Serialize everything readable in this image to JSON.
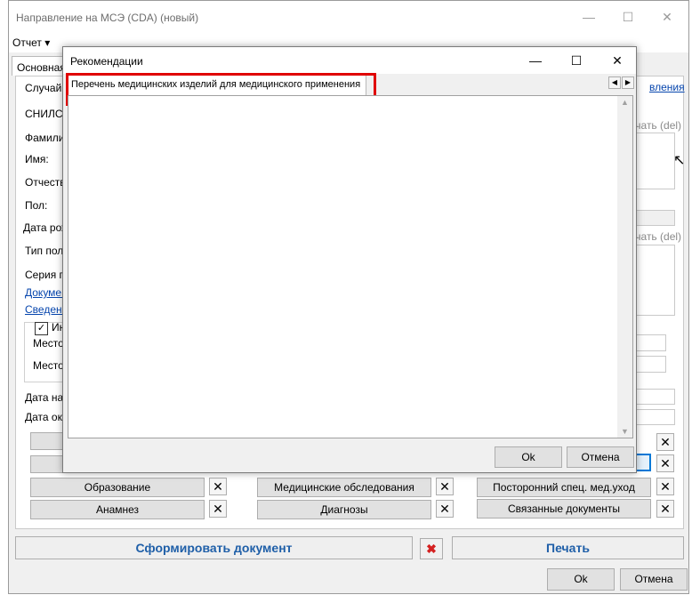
{
  "main": {
    "title": "Направление на МСЭ (CDA) (новый)",
    "menu_report": "Отчет",
    "tab_basic": "Основная",
    "fields": {
      "case": "Случай",
      "snils": "СНИЛС:",
      "surname": "Фамилия",
      "name": "Имя:",
      "patronymic": "Отчество",
      "sex": "Пол:",
      "birthdate": "Дата рож",
      "policy_type": "Тип поли",
      "series": "Серия по",
      "documents_link": "Докумен",
      "info_link": "Сведени",
      "checkbox_label": "Ин",
      "place1": "Место",
      "place2": "Место",
      "date_start": "Дата нач",
      "date_end": "Дата око"
    },
    "right_fragments": {
      "link": "вления",
      "print_del_1": "ечать (del)",
      "print_del_2": "ечать (del)"
    },
    "buttons": {
      "education": "Образование",
      "anamnesis": "Анамнез",
      "med_exams": "Медицинские обследования",
      "diagnoses": "Диагнозы",
      "outside_care": "Посторонний спец. мед.уход",
      "related_docs": "Связанные документы",
      "generate": "Сформировать документ",
      "print": "Печать",
      "ok": "Ok",
      "cancel": "Отмена"
    },
    "close_glyph": "✕"
  },
  "dialog": {
    "title": "Рекомендации",
    "tab": "Перечень медицинских изделий для медицинского применения",
    "ok": "Ok",
    "cancel": "Отмена"
  },
  "colors": {
    "highlight": "#e00000",
    "link": "#0645ad",
    "generate_text": "#1f5fa8"
  }
}
